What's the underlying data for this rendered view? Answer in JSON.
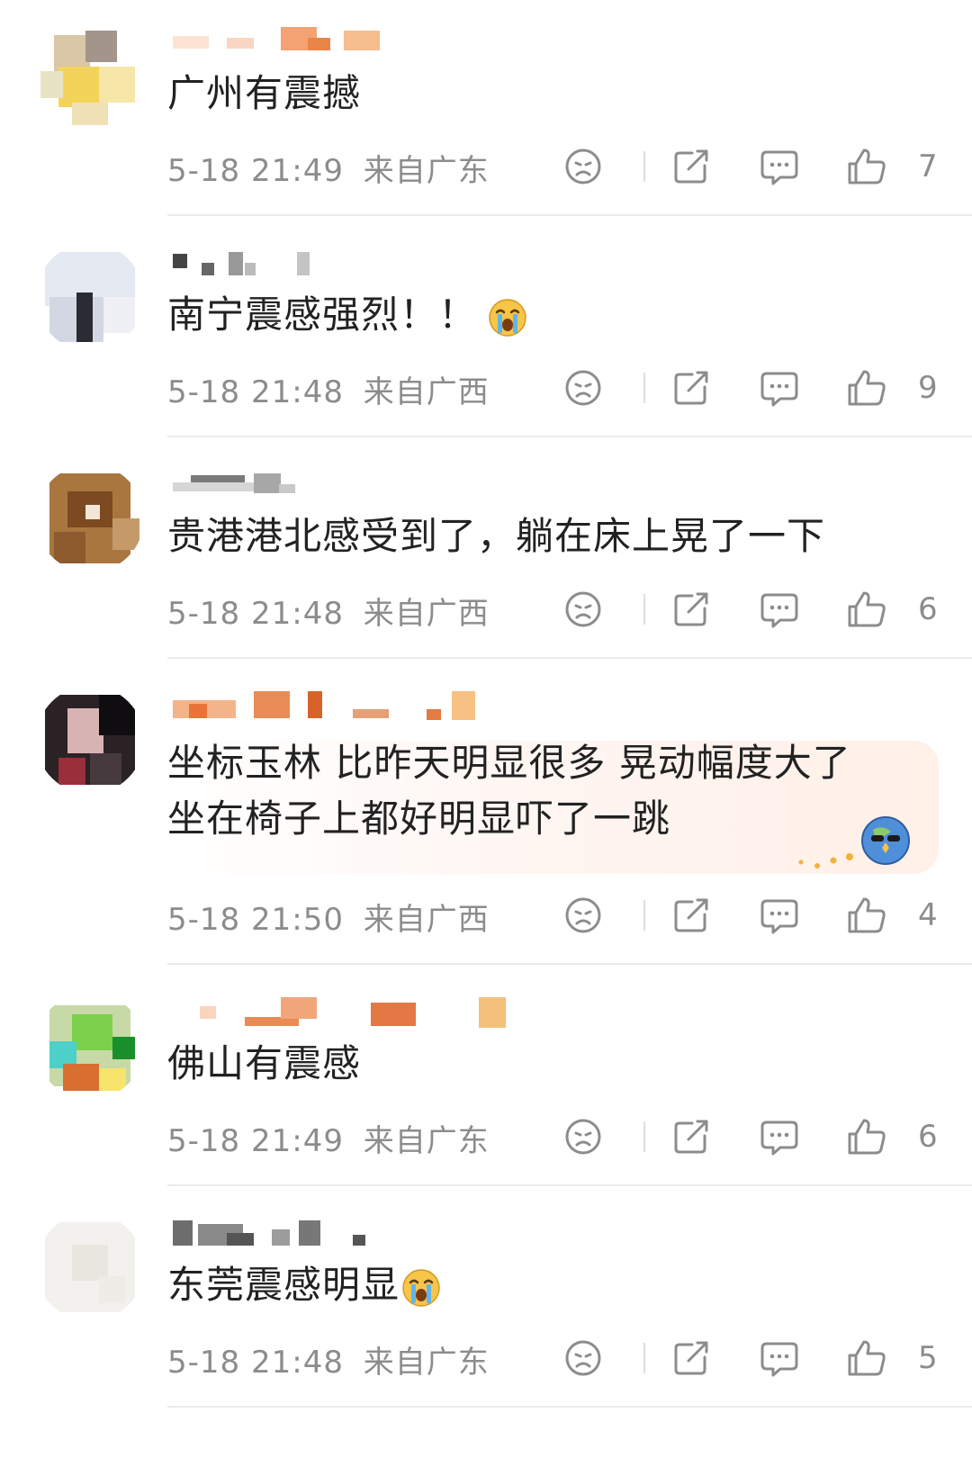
{
  "comments": [
    {
      "text": "广州有震撼",
      "time": "5-18 21:49",
      "location": "来自广东",
      "likes": "7"
    },
    {
      "text": "南宁震感强烈！！",
      "emoji": "crying-face",
      "time": "5-18 21:48",
      "location": "来自广西",
      "likes": "9"
    },
    {
      "text": "贵港港北感受到了，躺在床上晃了一下",
      "time": "5-18 21:48",
      "location": "来自广西",
      "likes": "6"
    },
    {
      "text": "坐标玉林 比昨天明显很多 晃动幅度大了",
      "text_line2": "坐在椅子上都好明显吓了一跳",
      "time": "5-18 21:50",
      "location": "来自广西",
      "likes": "4"
    },
    {
      "text": "佛山有震感",
      "time": "5-18 21:49",
      "location": "来自广东",
      "likes": "6"
    },
    {
      "text": "东莞震感明显",
      "emoji": "crying-face",
      "time": "5-18 21:48",
      "location": "来自广东",
      "likes": "5"
    }
  ],
  "icons": {
    "dislike": "frown-face-icon",
    "share": "share-icon",
    "reply": "comment-icon",
    "like": "thumbs-up-icon"
  },
  "colors": {
    "meta": "#8c8c8c",
    "text": "#222222",
    "divider": "#ececec",
    "highlight_bubble": "#fff0e8"
  }
}
